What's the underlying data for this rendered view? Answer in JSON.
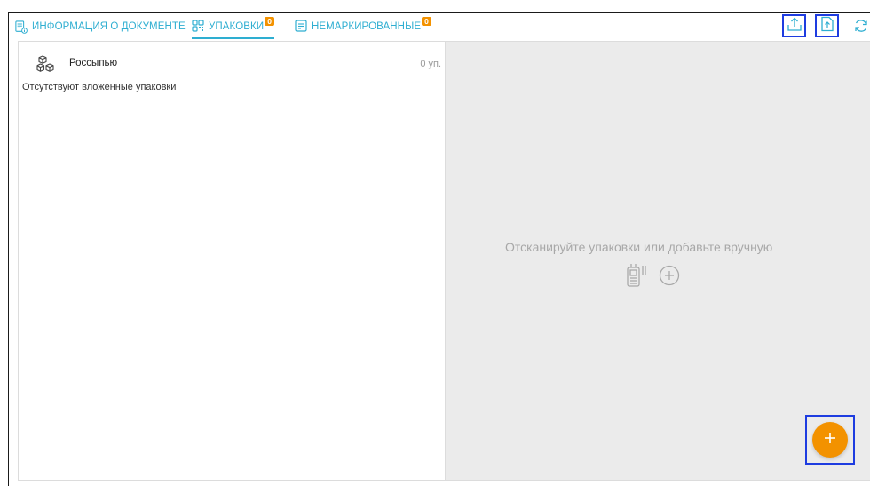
{
  "tabs": [
    {
      "label": "ИНФОРМАЦИЯ О ДОКУМЕНТЕ",
      "icon": "document-info-icon",
      "active": false
    },
    {
      "label": "УПАКОВКИ",
      "icon": "qr-code-icon",
      "badge": "0",
      "active": true
    },
    {
      "label": "НЕМАРКИРОВАННЫЕ",
      "icon": "list-document-icon",
      "badge": "0",
      "active": false
    }
  ],
  "toolbar": {
    "upload_icon": "upload-icon",
    "export_file_icon": "file-upload-icon",
    "refresh_icon": "refresh-icon"
  },
  "packages": {
    "items": [
      {
        "name": "Россыпью",
        "count": "0 уп.",
        "icon": "boxes-icon"
      }
    ],
    "empty_note": "Отсутствуют вложенные упаковки"
  },
  "scan_panel": {
    "hint": "Отсканируйте упаковки или добавьте вручную",
    "scanner_icon": "barcode-scanner-icon",
    "add_icon": "add-circle-icon"
  },
  "fab": {
    "icon": "plus-icon"
  },
  "colors": {
    "accent": "#2eaed1",
    "badge": "#f39200",
    "fab": "#f39200",
    "highlight": "#1e3ce0"
  }
}
